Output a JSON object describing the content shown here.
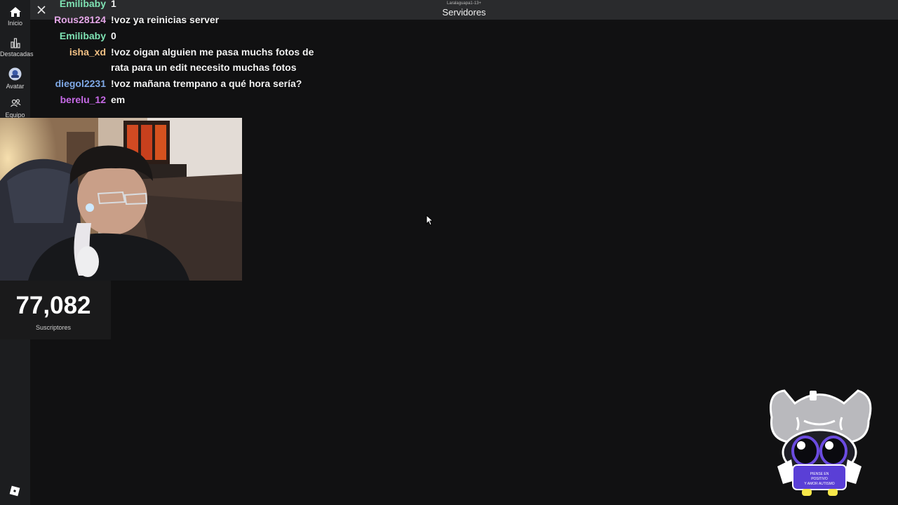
{
  "nav": {
    "items": [
      {
        "label": "Inicio",
        "icon": "home-icon"
      },
      {
        "label": "Destacadas",
        "icon": "chart-icon"
      },
      {
        "label": "Avatar",
        "icon": "avatar-icon"
      },
      {
        "label": "Equipo",
        "icon": "team-icon"
      }
    ],
    "bottom_icon": "roblox-logo-icon"
  },
  "header": {
    "subtitle": "Laralaguapa1-13+",
    "title": "Servidores",
    "close_icon": "close-icon"
  },
  "chat": {
    "messages": [
      {
        "user": "Emilibaby",
        "text": "1",
        "color": "#7fe3b4"
      },
      {
        "user": "Rous28124",
        "text": "!voz ya reinicias server",
        "color": "#e3a6e6"
      },
      {
        "user": "Emilibaby",
        "text": "0",
        "color": "#7fe3b4"
      },
      {
        "user": "isha_xd",
        "text": "!voz oigan alguien me pasa muchs fotos de rata para un edit necesito muchas fotos",
        "color": "#f4c285"
      },
      {
        "user": "diegol2231",
        "text": "!voz mañana trempano a qué hora sería?",
        "color": "#7fa9e6"
      },
      {
        "user": "berelu_12",
        "text": "em",
        "color": "#c66ae6"
      }
    ]
  },
  "subscribers": {
    "count": "77,082",
    "label": "Suscriptores"
  },
  "mascot": {
    "shirt_text": "PIENSE EN POSITIVO Y AMOR AUTISMO"
  }
}
